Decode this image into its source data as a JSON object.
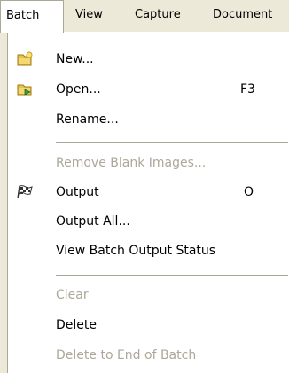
{
  "menubar": {
    "items": [
      {
        "label": "Batch"
      },
      {
        "label": "View"
      },
      {
        "label": "Capture"
      },
      {
        "label": "Document"
      }
    ]
  },
  "batch_menu": {
    "items": [
      {
        "label": "New...",
        "icon": "folder-new-icon",
        "enabled": true
      },
      {
        "label": "Open...",
        "shortcut": "F3",
        "icon": "folder-open-icon",
        "enabled": true
      },
      {
        "label": "Rename...",
        "enabled": true
      },
      {
        "label": "Remove Blank Images...",
        "enabled": false
      },
      {
        "label": "Output",
        "shortcut": "O",
        "icon": "checkered-flag-icon",
        "enabled": true
      },
      {
        "label": "Output All...",
        "enabled": true
      },
      {
        "label": "View Batch Output Status",
        "enabled": true
      },
      {
        "label": "Clear",
        "enabled": false
      },
      {
        "label": "Delete",
        "enabled": true
      },
      {
        "label": "Delete to End of Batch",
        "enabled": false
      }
    ]
  },
  "colors": {
    "menubar_bg": "#ece9d8",
    "border": "#aca899",
    "disabled_text": "#aca899",
    "menu_bg": "#ffffff"
  }
}
